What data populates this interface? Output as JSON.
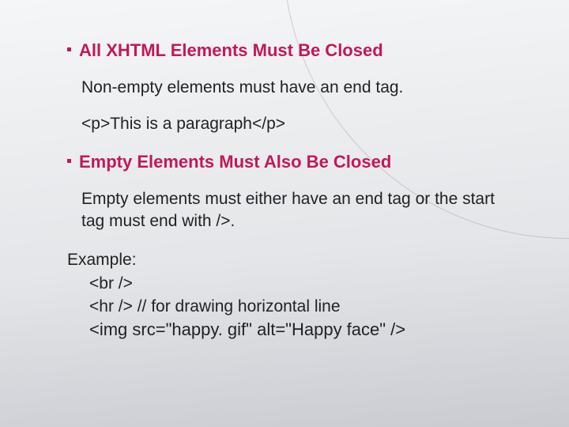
{
  "section1": {
    "heading": "All XHTML Elements Must Be Closed",
    "body": "Non-empty elements must have an end tag.",
    "code": "<p>This is a paragraph</p>"
  },
  "section2": {
    "heading": "Empty Elements Must Also Be Closed",
    "body": "Empty elements must either have an end tag or the start tag must end with />."
  },
  "example": {
    "label": "Example:",
    "line1": "<br />",
    "line2": "<hr /> // for drawing horizontal line",
    "line3": "<img src=\"happy. gif\" alt=\"Happy face\" />"
  }
}
